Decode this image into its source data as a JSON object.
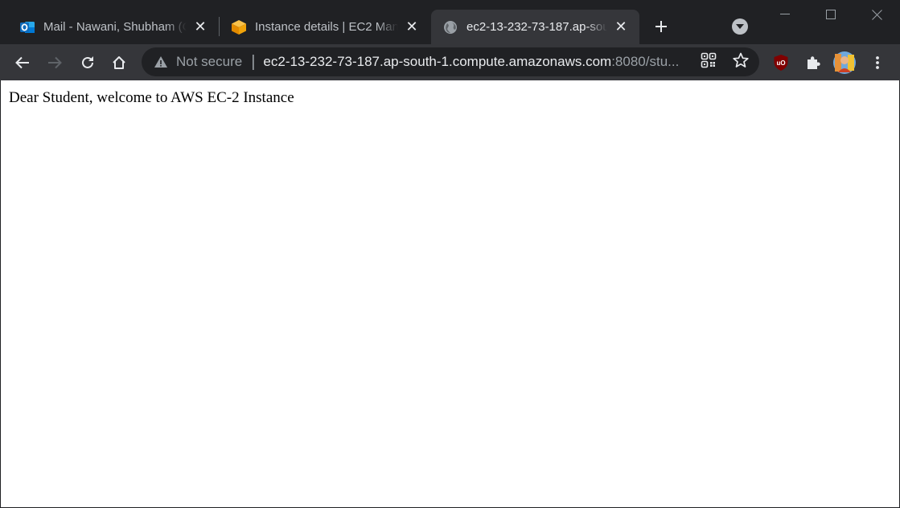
{
  "tabs": [
    {
      "title": "Mail - Nawani, Shubham (C",
      "icon": "outlook-icon",
      "active": false
    },
    {
      "title": "Instance details | EC2 Mana",
      "icon": "aws-box-icon",
      "active": false
    },
    {
      "title": "ec2-13-232-73-187.ap-sout",
      "icon": "globe-icon",
      "active": true
    }
  ],
  "toolbar": {
    "security_label": "Not secure",
    "url_host": "ec2-13-232-73-187.ap-south-1.compute.amazonaws.com",
    "url_rest": ":8080/stu..."
  },
  "page": {
    "text": "Dear Student, welcome to AWS EC-2 Instance"
  },
  "colors": {
    "frame": "#202124",
    "toolbar": "#35363a",
    "page_background": "#ffffff",
    "outlook_blue": "#0f6cbd",
    "aws_orange": "#f0a30a",
    "ublock_red": "#800000"
  }
}
